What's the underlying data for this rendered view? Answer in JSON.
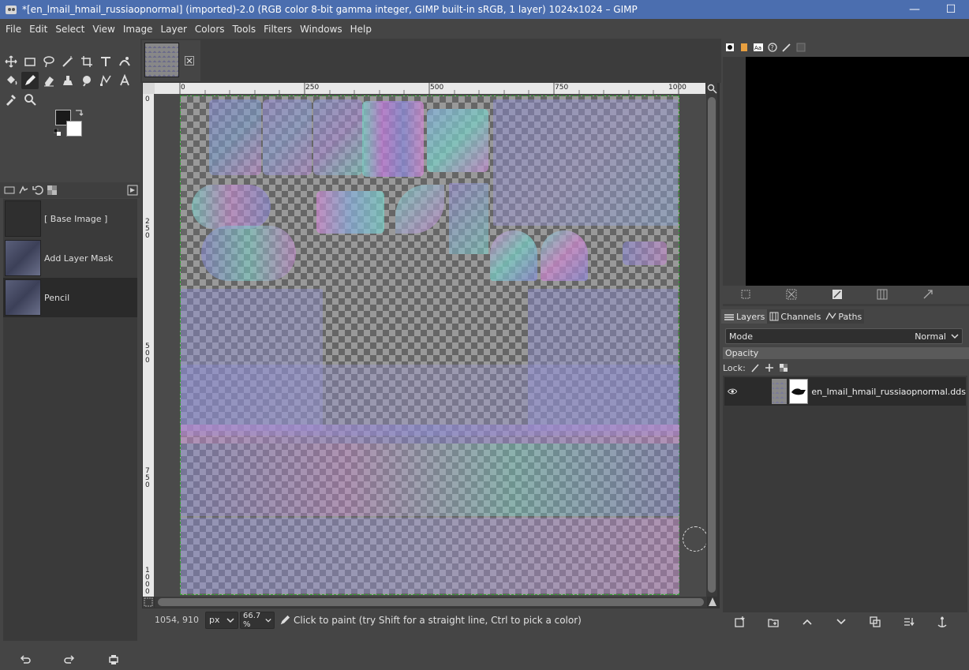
{
  "window": {
    "title": "*[en_lmail_hmail_russiaopnormal] (imported)-2.0 (RGB color 8-bit gamma integer, GIMP built-in sRGB, 1 layer) 1024x1024 – GIMP",
    "minimize": "—",
    "maximize": "☐"
  },
  "menu": [
    "File",
    "Edit",
    "Select",
    "View",
    "Image",
    "Layer",
    "Colors",
    "Tools",
    "Filters",
    "Windows",
    "Help"
  ],
  "undo_history": [
    {
      "label": "[ Base Image ]"
    },
    {
      "label": "Add Layer Mask"
    },
    {
      "label": "Pencil"
    }
  ],
  "ruler": {
    "top_ticks": [
      "0",
      "250",
      "500",
      "750",
      "1000"
    ],
    "left_ticks": [
      "0",
      "2\n5\n0",
      "5\n0\n0",
      "7\n5\n0",
      "1\n0\n0\n0"
    ]
  },
  "statusbar": {
    "coords": "1054, 910",
    "unit": "px",
    "zoom": "66.7 %",
    "message": "Click to paint (try Shift for a straight line, Ctrl to pick a color)"
  },
  "dock": {
    "tabs": [
      {
        "label": "Layers"
      },
      {
        "label": "Channels"
      },
      {
        "label": "Paths"
      }
    ],
    "mode_label": "Mode",
    "mode_value": "Normal",
    "opacity_label": "Opacity",
    "lock_label": "Lock:",
    "layer_name": "en_lmail_hmail_russiaopnormal.dds"
  },
  "colors": {
    "titlebar": "#4b6eaf",
    "normal_blue": "#8a8ad8",
    "normal_pink": "#d28ad2",
    "normal_teal": "#7ad2c8"
  }
}
